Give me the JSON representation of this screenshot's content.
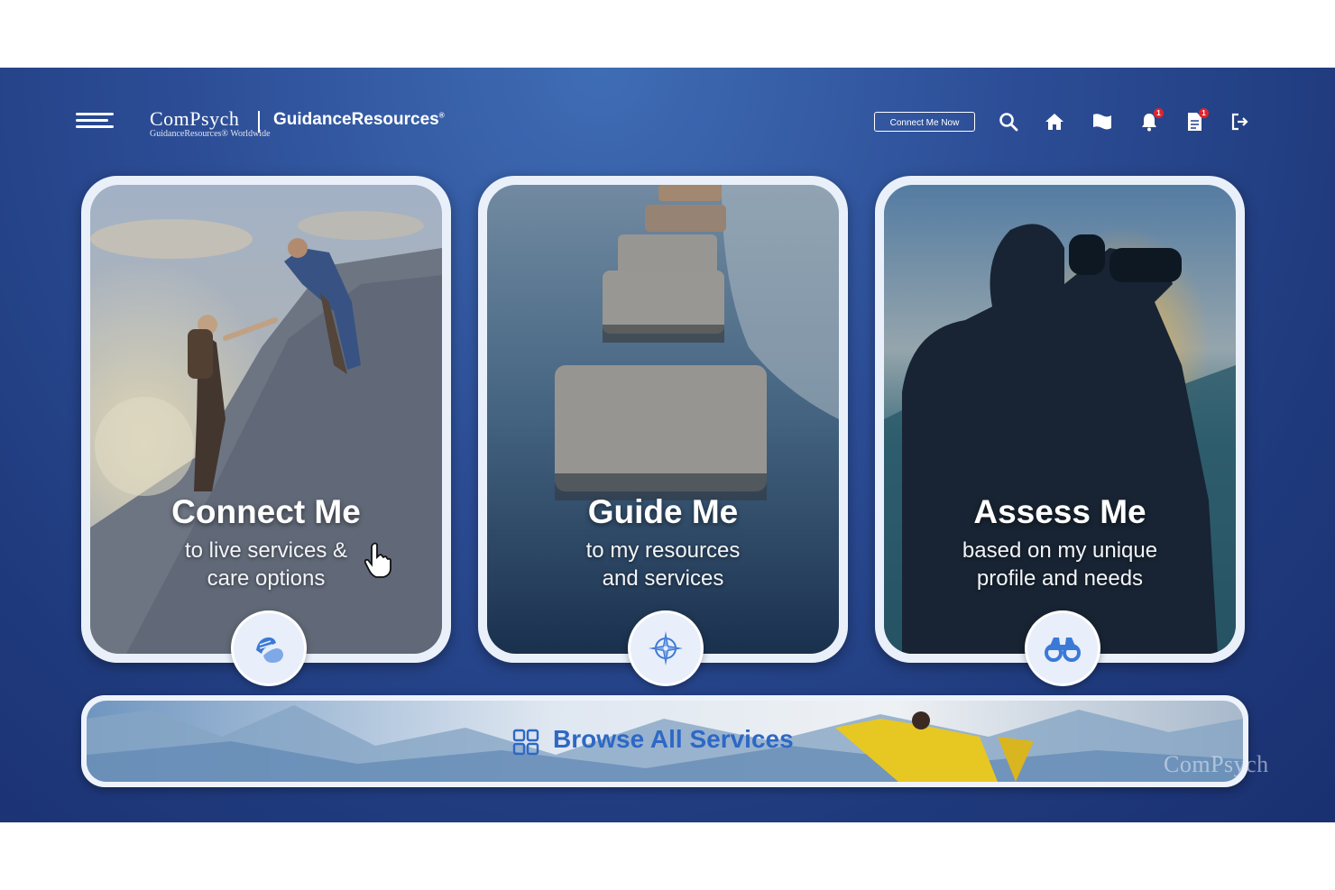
{
  "header": {
    "brand": "ComPsych",
    "brand_tagline": "GuidanceResources® Worldwide",
    "product": "GuidanceResources",
    "product_mark": "®",
    "connect_now_label": "Connect Me Now",
    "notification_count": "1",
    "messages_count": "1"
  },
  "cards": [
    {
      "title": "Connect Me",
      "sub1": "to live services &",
      "sub2": "care options"
    },
    {
      "title": "Guide Me",
      "sub1": "to my resources",
      "sub2": "and services"
    },
    {
      "title": "Assess Me",
      "sub1": "based on my unique",
      "sub2": "profile and needs"
    }
  ],
  "browse": {
    "label": "Browse All Services"
  },
  "watermark": "ComPsych",
  "colors": {
    "background": "#2c4d96",
    "accent": "#2e68c5",
    "badge": "#e0242c"
  },
  "icons": [
    "menu-icon",
    "search-icon",
    "home-icon",
    "flag-icon",
    "bell-icon",
    "document-icon",
    "logout-icon",
    "helping-hands-icon",
    "compass-icon",
    "binoculars-icon",
    "grid-icon"
  ]
}
